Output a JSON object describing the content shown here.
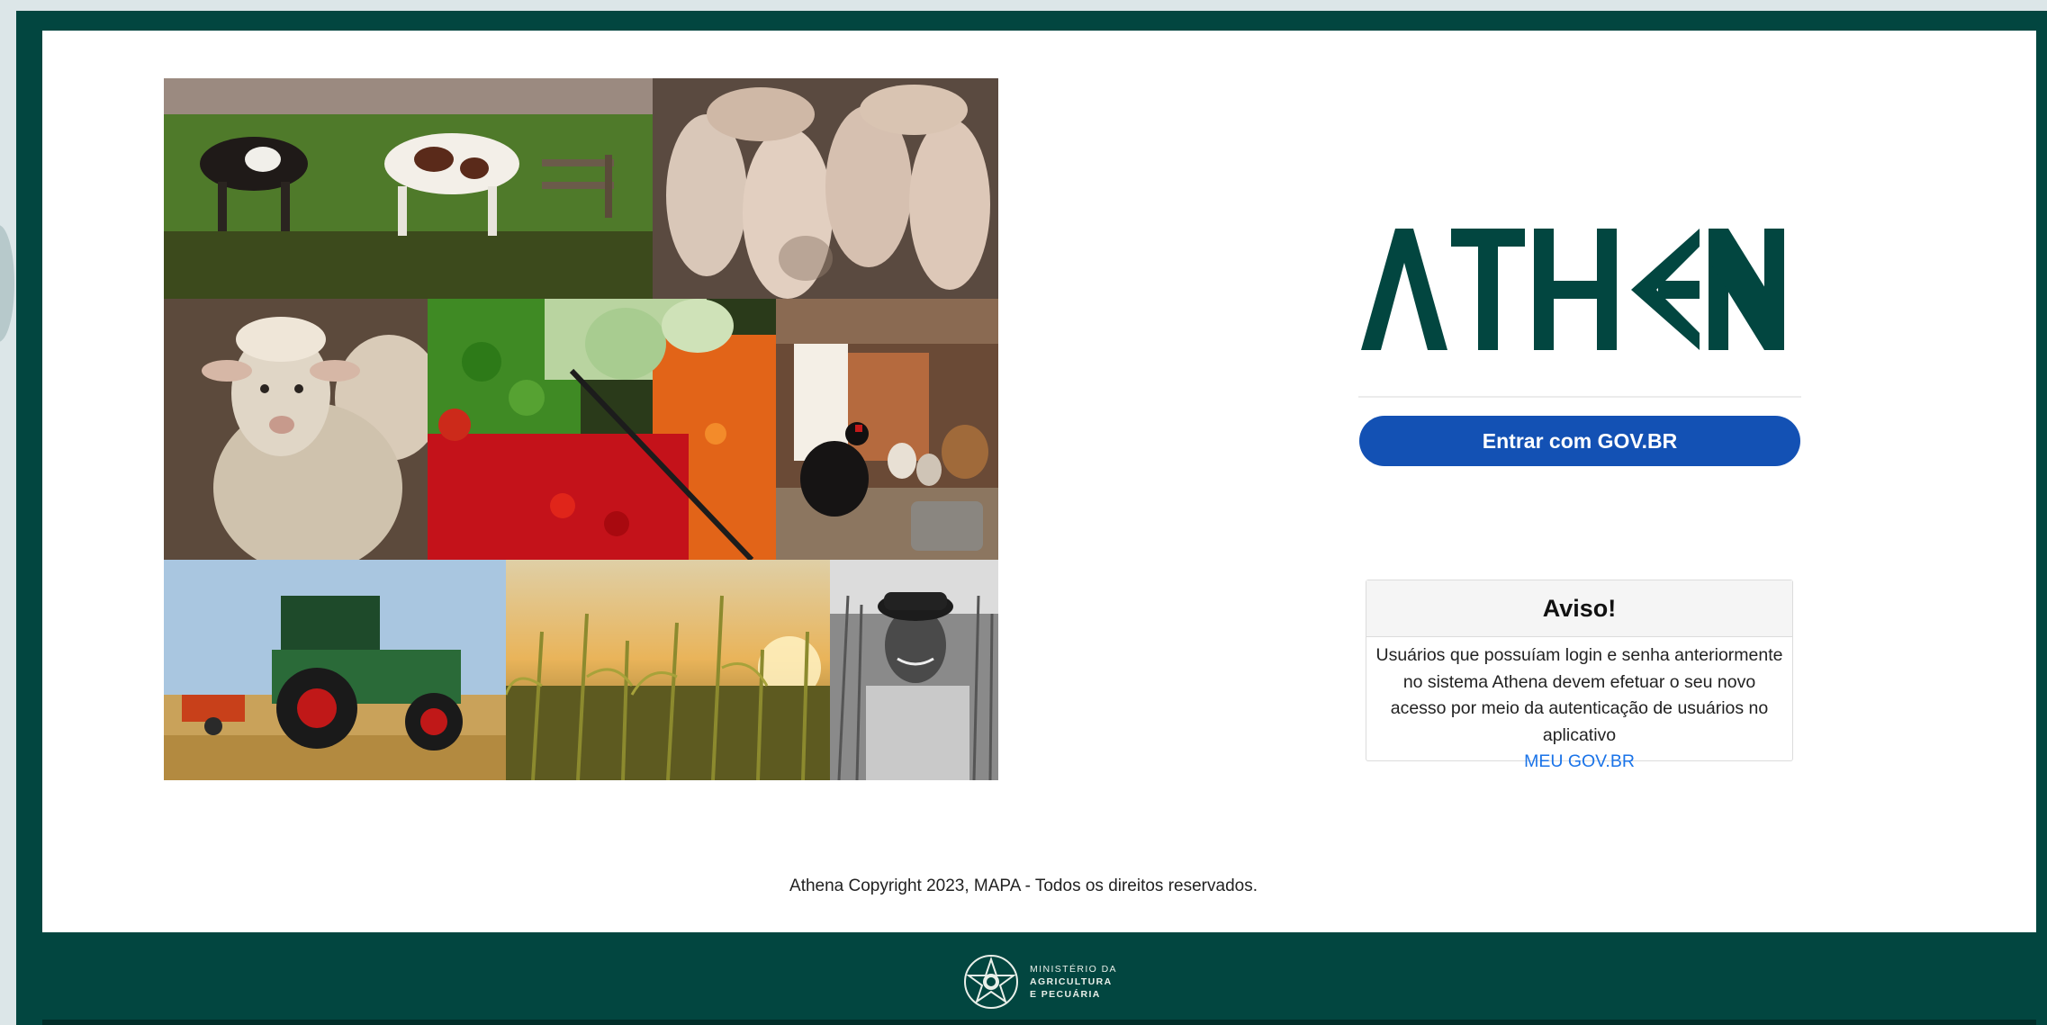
{
  "brand": {
    "name": "ATHENA",
    "color": "#024640"
  },
  "collage": {
    "tiles": [
      {
        "name": "cows-photo",
        "subject": "cows in pasture"
      },
      {
        "name": "pigs-photo",
        "subject": "pigs in pen"
      },
      {
        "name": "sheep-photo",
        "subject": "sheep"
      },
      {
        "name": "vegetables-photo",
        "subject": "vegetables at market"
      },
      {
        "name": "chickens-photo",
        "subject": "chickens in barn"
      },
      {
        "name": "tractor-photo",
        "subject": "tractor in field"
      },
      {
        "name": "corn-photo",
        "subject": "corn field at sunset"
      },
      {
        "name": "farmer-photo",
        "subject": "farmer portrait"
      }
    ]
  },
  "login": {
    "button_label": "Entrar com GOV.BR",
    "button_color": "#1351b4"
  },
  "notice": {
    "title": "Aviso!",
    "body": "Usuários que possuíam login e senha anteriormente no sistema Athena devem efetuar o seu novo acesso por meio da autenticação de usuários no aplicativo",
    "link_label": "MEU GOV.BR"
  },
  "footer": {
    "copyright": "Athena Copyright 2023, MAPA - Todos os direitos reservados.",
    "ministry_line1": "MINISTÉRIO DA",
    "ministry_line2": "AGRICULTURA",
    "ministry_line3": "E PECUÁRIA"
  }
}
